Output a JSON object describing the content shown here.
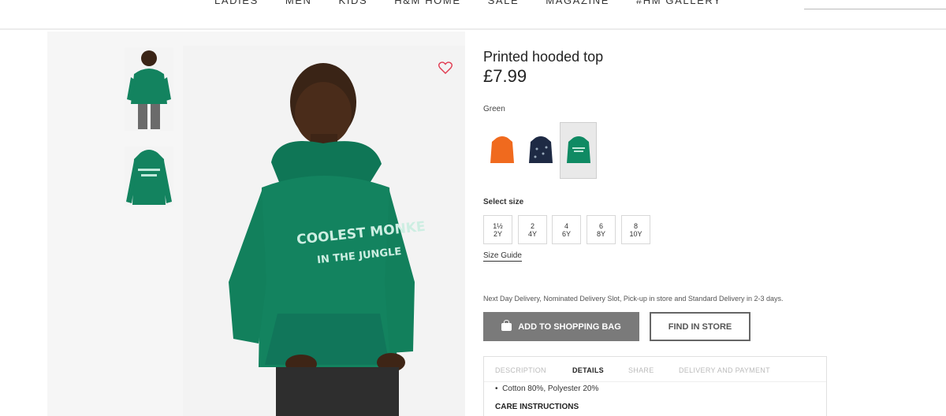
{
  "nav": {
    "links": [
      "LADIES",
      "MEN",
      "KIDS",
      "H&M HOME",
      "SALE",
      "MAGAZINE",
      "#HM GALLERY"
    ]
  },
  "product": {
    "title": "Printed hooded top",
    "price": "£7.99",
    "color_label": "Green",
    "hoodie_print_line1": "COOLEST MONKE",
    "hoodie_print_line2": "IN THE JUNGLE"
  },
  "swatches": [
    {
      "name": "orange",
      "color": "#f06a1e",
      "selected": false
    },
    {
      "name": "navy",
      "color": "#1e2a44",
      "selected": false
    },
    {
      "name": "green",
      "color": "#0f8a63",
      "selected": true
    }
  ],
  "size": {
    "label": "Select size",
    "options": [
      {
        "line1": "1½",
        "line2": "2Y"
      },
      {
        "line1": "2",
        "line2": "4Y"
      },
      {
        "line1": "4",
        "line2": "6Y"
      },
      {
        "line1": "6",
        "line2": "8Y"
      },
      {
        "line1": "8",
        "line2": "10Y"
      }
    ],
    "guide": "Size Guide"
  },
  "delivery_text": "Next Day Delivery, Nominated Delivery Slot, Pick-up in store and Standard Delivery in 2-3 days.",
  "buttons": {
    "add": "ADD TO SHOPPING BAG",
    "find": "FIND IN STORE"
  },
  "tabs": [
    {
      "label": "DESCRIPTION",
      "active": false
    },
    {
      "label": "DETAILS",
      "active": true
    },
    {
      "label": "SHARE",
      "active": false
    },
    {
      "label": "DELIVERY AND PAYMENT",
      "active": false
    }
  ],
  "details": {
    "material": "Cotton 80%, Polyester 20%",
    "care_heading": "CARE INSTRUCTIONS"
  },
  "colors": {
    "hoodie_green": "#13835f",
    "button_grey": "#7a7a7a"
  }
}
